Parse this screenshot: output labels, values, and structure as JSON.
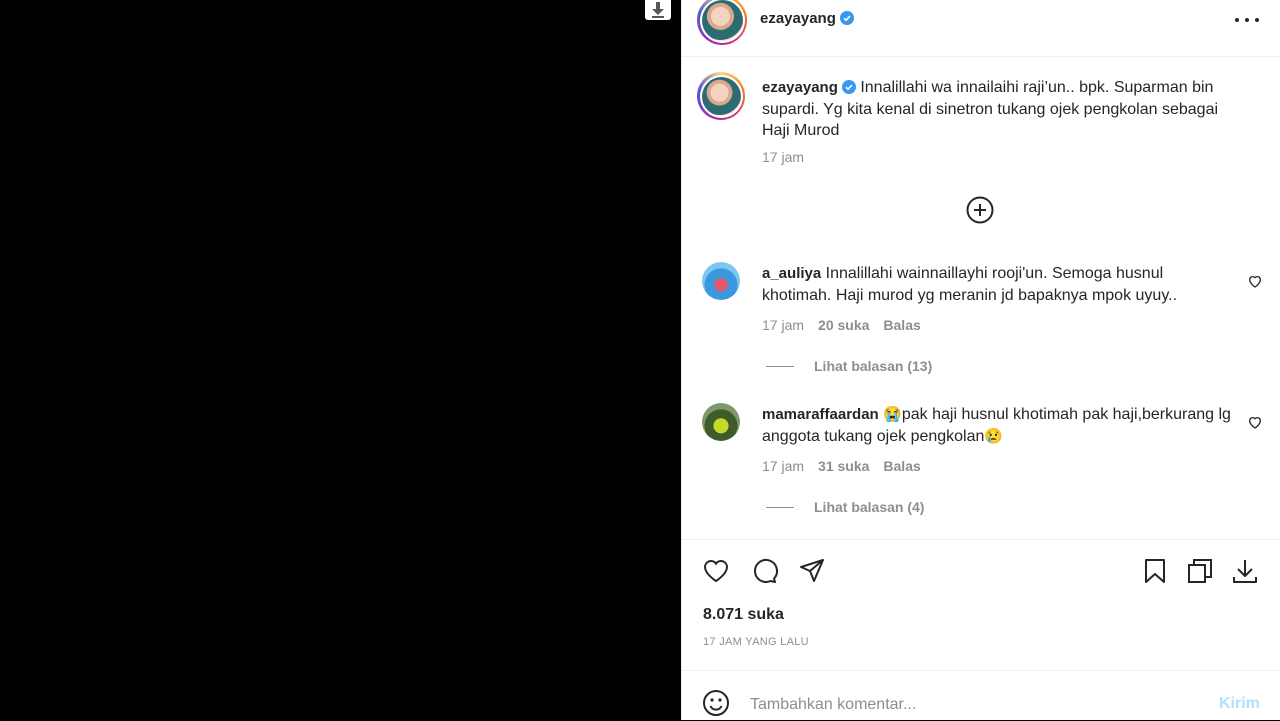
{
  "post": {
    "username": "ezayayang",
    "caption_text": " Innalillahi wa innailaihi raji’un.. bpk. Suparman bin supardi. Yg kita kenal di sinetron tukang ojek pengkolan sebagai Haji Murod",
    "caption_time": "17 jam"
  },
  "comments": [
    {
      "username": "a_auliya",
      "text": " Innalillahi wainnaillayhi rooji'un. Semoga husnul khotimah. Haji murod yg meranin jd bapaknya mpok uyuy..",
      "time": "17 jam",
      "likes": "20 suka",
      "reply_label": "Balas",
      "view_replies": "Lihat balasan (13)"
    },
    {
      "username": "mamaraffaardan",
      "emoji_start": "😭",
      "text": "pak haji husnul khotimah pak haji,berkurang lg anggota tukang ojek pengkolan",
      "emoji_end": "😢",
      "time": "17 jam",
      "likes": "31 suka",
      "reply_label": "Balas",
      "view_replies": "Lihat balasan (4)"
    }
  ],
  "stats": {
    "likes": "8.071 suka",
    "posted_ago": "17 JAM YANG LALU"
  },
  "add_comment": {
    "placeholder": "Tambahkan komentar...",
    "post_label": "Kirim"
  },
  "colors": {
    "verified": "#3897f0",
    "post_button_disabled": "#b2dffc",
    "muted_text": "#8e8e8e"
  },
  "icons": [
    "download-icon",
    "more-options-icon",
    "verified-badge-icon",
    "add-circle-icon",
    "heart-icon",
    "comment-icon",
    "share-icon",
    "bookmark-icon",
    "copy-icon",
    "emoji-icon"
  ]
}
